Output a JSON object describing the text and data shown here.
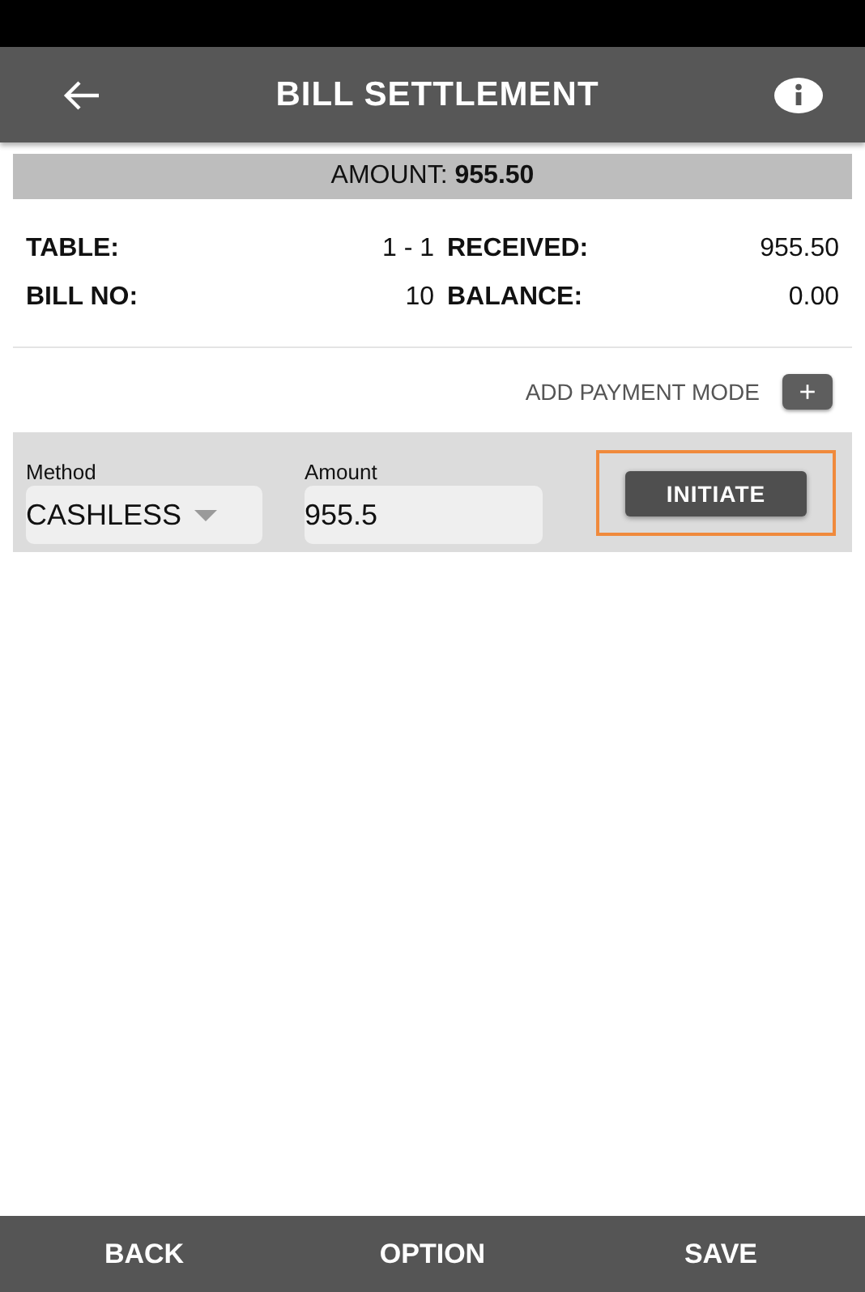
{
  "header": {
    "title": "BILL SETTLEMENT"
  },
  "amount": {
    "label": "AMOUNT:",
    "value": "955.50"
  },
  "details": [
    {
      "label": "TABLE:",
      "value": "1 - 1"
    },
    {
      "label": "RECEIVED:",
      "value": "955.50"
    },
    {
      "label": "BILL NO:",
      "value": "10"
    },
    {
      "label": "BALANCE:",
      "value": "0.00"
    }
  ],
  "add_payment": {
    "label": "ADD PAYMENT MODE",
    "button": "+"
  },
  "payments": [
    {
      "method_label": "Method",
      "method": "CASHLESS",
      "amount_label": "Amount",
      "amount": "955.5",
      "action": "INITIATE",
      "highlighted": true
    }
  ],
  "footer": [
    "BACK",
    "OPTION",
    "SAVE"
  ]
}
